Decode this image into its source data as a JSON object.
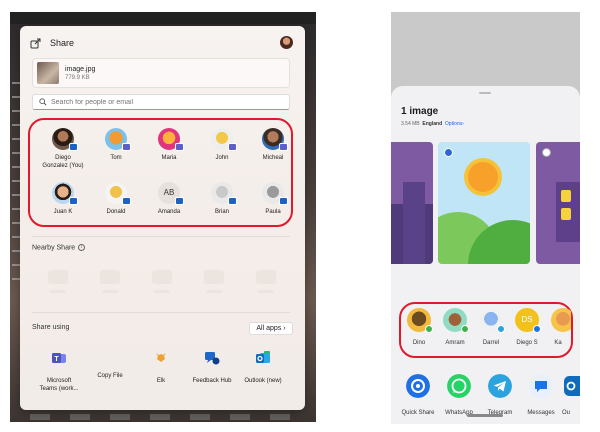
{
  "windows_share": {
    "title": "Share",
    "file": {
      "name": "image.jpg",
      "size": "779.9 KB"
    },
    "search_placeholder": "Search for people or email",
    "people": [
      {
        "name": "Diego\nGonzalez (You)",
        "badge": "outlook"
      },
      {
        "name": "Tom",
        "badge": "teams"
      },
      {
        "name": "Maria",
        "badge": "teams"
      },
      {
        "name": "John",
        "badge": "teams"
      },
      {
        "name": "Micheal",
        "badge": "teams"
      },
      {
        "name": "Juan K",
        "badge": "outlook"
      },
      {
        "name": "Donald",
        "badge": "outlook"
      },
      {
        "name": "Amanda",
        "initials": "AB",
        "badge": "outlook"
      },
      {
        "name": "Brian",
        "badge": "outlook"
      },
      {
        "name": "Paula",
        "badge": "outlook"
      }
    ],
    "nearby_label": "Nearby Share",
    "share_using_label": "Share using",
    "all_apps_label": "All apps",
    "apps": [
      {
        "name": "Microsoft\nTeams (work...",
        "icon": "teams-icon"
      },
      {
        "name": "Copy File",
        "icon": "copy-icon"
      },
      {
        "name": "Elk",
        "icon": "elk-icon"
      },
      {
        "name": "Feedback Hub",
        "icon": "feedback-icon"
      },
      {
        "name": "Outlook (new)",
        "icon": "outlook-icon"
      }
    ]
  },
  "android_share": {
    "title": "1 image",
    "size": "3.54 MB",
    "location": "England",
    "options_label": "Options",
    "people": [
      {
        "name": "Dino"
      },
      {
        "name": "Amram"
      },
      {
        "name": "Darrel"
      },
      {
        "name": "Diego S",
        "initials": "DS"
      },
      {
        "name": "Ka"
      }
    ],
    "apps": [
      {
        "name": "Quick Share",
        "icon": "quick-share-icon",
        "color": "#1f6fe5"
      },
      {
        "name": "WhatsApp",
        "icon": "whatsapp-icon",
        "color": "#25d366"
      },
      {
        "name": "Telegram",
        "icon": "telegram-icon",
        "color": "#2aa3de"
      },
      {
        "name": "Messages",
        "icon": "messages-icon",
        "color": "#1a73e8"
      },
      {
        "name": "Ou",
        "icon": "outlook-icon",
        "color": "#0f6cbd"
      }
    ]
  }
}
